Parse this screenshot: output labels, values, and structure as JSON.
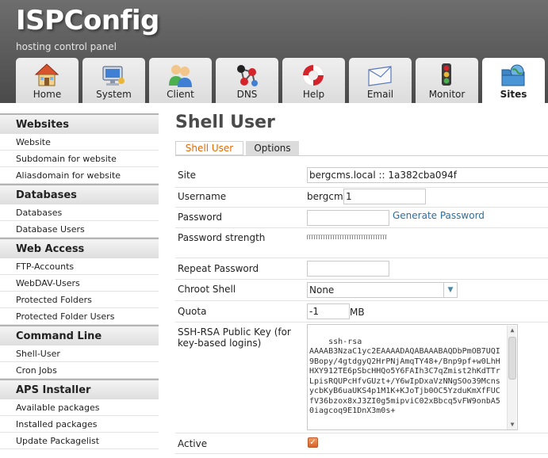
{
  "header": {
    "title": "ISPConfig",
    "subtitle": "hosting control panel",
    "tabs": [
      {
        "label": "Home",
        "icon": "home-icon"
      },
      {
        "label": "System",
        "icon": "computer-icon"
      },
      {
        "label": "Client",
        "icon": "users-icon"
      },
      {
        "label": "DNS",
        "icon": "network-icon"
      },
      {
        "label": "Help",
        "icon": "lifebuoy-icon"
      },
      {
        "label": "Email",
        "icon": "envelope-icon"
      },
      {
        "label": "Monitor",
        "icon": "traffic-light-icon"
      },
      {
        "label": "Sites",
        "icon": "globe-folder-icon",
        "active": true
      }
    ]
  },
  "sidebar": {
    "sections": [
      {
        "title": "Websites",
        "items": [
          "Website",
          "Subdomain for website",
          "Aliasdomain for website"
        ]
      },
      {
        "title": "Databases",
        "items": [
          "Databases",
          "Database Users"
        ]
      },
      {
        "title": "Web Access",
        "items": [
          "FTP-Accounts",
          "WebDAV-Users",
          "Protected Folders",
          "Protected Folder Users"
        ]
      },
      {
        "title": "Command Line",
        "items": [
          "Shell-User",
          "Cron Jobs"
        ]
      },
      {
        "title": "APS Installer",
        "items": [
          "Available packages",
          "Installed packages",
          "Update Packagelist"
        ]
      }
    ]
  },
  "main": {
    "title": "Shell User",
    "tabs": [
      {
        "label": "Shell User",
        "active": true
      },
      {
        "label": "Options",
        "active": false
      }
    ],
    "form": {
      "site_label": "Site",
      "site_value": "bergcms.local :: 1a382cba094f",
      "username_label": "Username",
      "username_prefix": "bergcms",
      "username_value": "1",
      "password_label": "Password",
      "password_value": "",
      "generate_password": "Generate Password",
      "password_strength_label": "Password strength",
      "repeat_password_label": "Repeat Password",
      "repeat_password_value": "",
      "chroot_label": "Chroot Shell",
      "chroot_value": "None",
      "quota_label": "Quota",
      "quota_value": "-1",
      "quota_unit": "MB",
      "ssh_key_label": "SSH-RSA Public Key (for key-based logins)",
      "ssh_key_value": "ssh-rsa\nAAAAB3NzaC1yc2EAAAADAQABAAABAQDbPmOB7UQI9Bopy/4gtdgyQ2HrPNjAmqTY48+/Bnp9pf+w0LhHHXY912TE6pSbcHHQo5Y6FAIh3C7qZmist2hKdTTrLpisRQUPcHfvGUzt+/Y6wIpDxaVzNNgSOo39McnsycbKyB6uaUKS4p1M1K+KJoTjb0OC5YzduKmXfFUCfV36bzox8xJ3ZI0g5mipviC02xBbcq5vFW9onbA50iagcoq9E1DnX3m0s+",
      "active_label": "Active",
      "active_checked": true
    }
  },
  "colors": {
    "header_bg": "#5a5a5a",
    "active_tab_text": "#e06a00",
    "link": "#2d6f9c",
    "checkbox": "#e07a3c"
  }
}
